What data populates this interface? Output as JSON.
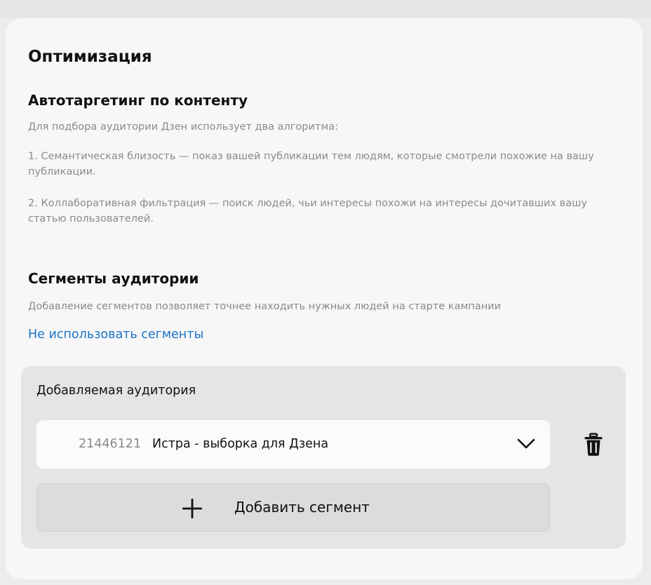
{
  "page": {
    "title": "Оптимизация"
  },
  "autotargeting": {
    "heading": "Автотаргетинг по контенту",
    "intro": "Для подбора аудитории Дзен использует два алгоритма:",
    "item1": "1. Семантическая близость — показ вашей публикации тем людям, которые смотрели похожие на вашу публикации.",
    "item2": "2. Коллаборативная фильтрация — поиск людей, чьи интересы похожи на интересы дочитавших вашу статью пользователей."
  },
  "segments": {
    "heading": "Сегменты аудитории",
    "description": "Добавление сегментов позволяет точнее находить нужных людей на старте кампании",
    "disable_link": "Не использовать сегменты"
  },
  "audience": {
    "title": "Добавляемая аудитория",
    "selected": {
      "id": "21446121",
      "name": "Истра - выборка для Дзена"
    },
    "add_button_label": "Добавить сегмент"
  },
  "icons": {
    "chevron": "chevron-down-icon",
    "trash": "trash-icon",
    "plus": "plus-icon"
  },
  "colors": {
    "link": "#1a73c8",
    "muted_text": "#8a8a8a",
    "card_bg": "#f7f7f7",
    "panel_bg": "#e5e5e5"
  }
}
